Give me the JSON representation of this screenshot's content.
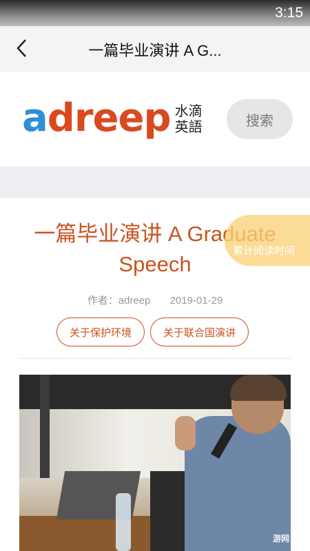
{
  "status": {
    "time": "3:15"
  },
  "nav": {
    "title": "一篇毕业演讲 A G...",
    "back_icon": "chevron-left-icon"
  },
  "brand": {
    "logo": [
      {
        "ch": "a",
        "color": "#2d8fd8"
      },
      {
        "ch": "d",
        "color": "#d94a1e"
      },
      {
        "ch": "r",
        "color": "#d94a1e"
      },
      {
        "ch": "e",
        "color": "#d94a1e"
      },
      {
        "ch": "e",
        "color": "#d94a1e"
      },
      {
        "ch": "p",
        "color": "#d94a1e"
      }
    ],
    "logo_cn_line1": "水滴",
    "logo_cn_line2": "英語",
    "search_label": "搜索"
  },
  "article": {
    "title": "一篇毕业演讲 A Graduate Speech",
    "read_time_label": "累计阅读时间",
    "author": "作者：adreep",
    "date": "2019-01-29",
    "tags": [
      "关于保护环境",
      "关于联合国演讲"
    ],
    "image_icon": "speaker-photo"
  },
  "watermark": "游网"
}
